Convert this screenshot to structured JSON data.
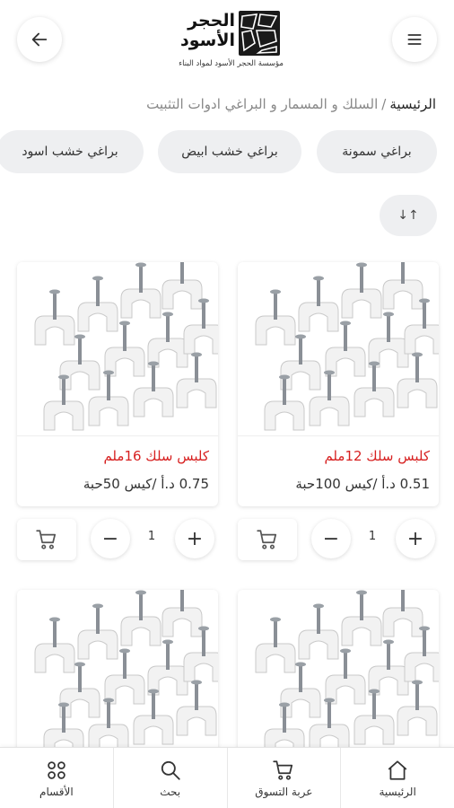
{
  "header": {
    "logo_line1": "الحجر",
    "logo_line2": "الأسود",
    "logo_subtitle": "مؤسسة الحجر الأسود لمواد البناء"
  },
  "breadcrumb": {
    "home": "الرئيسية",
    "separator": "/",
    "current": "السلك و المسمار و البراغي ادوات التثبيت"
  },
  "chips": [
    "براغي سمونة",
    "براغي خشب ابيض",
    "براغي خشب اسود"
  ],
  "sort_label": "↓↑",
  "products": [
    {
      "title": "كلبس سلك 12ملم",
      "price": "0.51 د.أ /كيس 100حبة",
      "qty": "1"
    },
    {
      "title": "كلبس سلك 16ملم",
      "price": "0.75 د.أ /كيس 50حبة",
      "qty": "1"
    }
  ],
  "bottom_nav": {
    "home": "الرئيسية",
    "cart": "عربة التسوق",
    "search": "بحث",
    "categories": "الأقسام"
  },
  "colors": {
    "accent_red": "#d72020"
  },
  "icons": [
    "back-arrow-icon",
    "hamburger-menu-icon",
    "sort-icon",
    "cart-icon",
    "minus-icon",
    "plus-icon",
    "home-icon",
    "search-icon",
    "grid-icon"
  ]
}
